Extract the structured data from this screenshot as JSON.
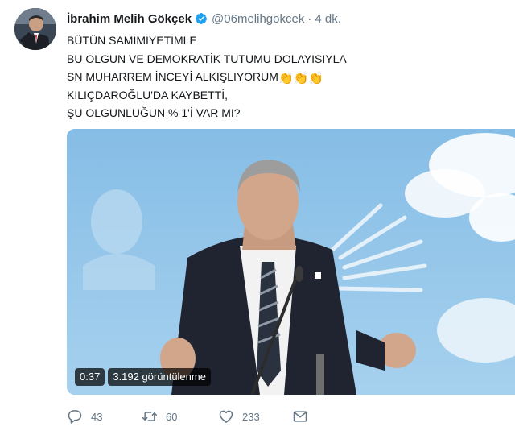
{
  "author": {
    "name": "İbrahim Melih Gökçek",
    "handle": "@06melihgokcek",
    "separator": "·",
    "time": "4 dk."
  },
  "tweet": {
    "lines": [
      "BÜTÜN SAMİMİYETİMLE",
      "BU OLGUN VE DEMOKRATİK TUTUMU DOLAYISIYLA",
      "SN MUHARREM İNCEYİ ALKIŞLIYORUM",
      "KILIÇDAROĞLU'DA KAYBETTİ,",
      "ŞU OLGUNLUĞUN % 1'İ VAR MI?"
    ],
    "emoji": [
      "👏",
      "👏",
      "👏"
    ]
  },
  "video": {
    "duration": "0:37",
    "views": "3.192 görüntülenme"
  },
  "actions": {
    "replies": "43",
    "retweets": "60",
    "likes": "233"
  },
  "icons": {
    "verified": "verified-badge-icon",
    "reply": "reply-icon",
    "retweet": "retweet-icon",
    "like": "heart-icon",
    "dm": "envelope-icon"
  },
  "colors": {
    "verified": "#1da1f2",
    "secondary_text": "#657786",
    "video_sky": "#8fc3e8"
  }
}
